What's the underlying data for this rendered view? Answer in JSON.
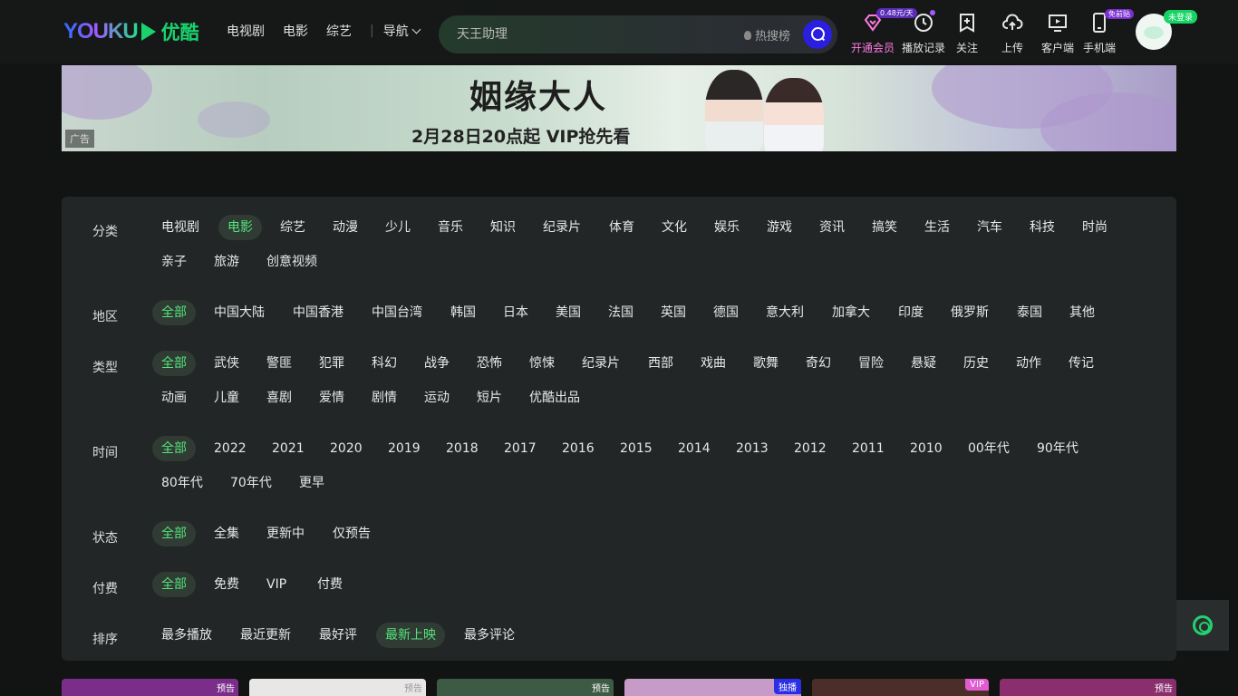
{
  "header": {
    "logo_en": "YOUKU",
    "logo_cn": "优酷",
    "nav": [
      "电视剧",
      "电影",
      "综艺"
    ],
    "nav_more": "导航",
    "search": {
      "placeholder": "天王助理",
      "hot_label": "热搜榜"
    },
    "tools": [
      {
        "label": "开通会员",
        "icon": "diamond-icon"
      },
      {
        "label": "播放记录",
        "icon": "clock-icon"
      },
      {
        "label": "关注",
        "icon": "bookmark-plus-icon"
      },
      {
        "label": "上传",
        "icon": "cloud-upload-icon"
      },
      {
        "label": "客户端",
        "icon": "monitor-play-icon"
      },
      {
        "label": "手机端",
        "icon": "phone-icon"
      }
    ],
    "vip_price_badge": "0.48元/天",
    "mobile_badge": "免前贴",
    "login_tag": "未登录",
    "accent": "#19d36e"
  },
  "ad": {
    "title": "姻缘大人",
    "subtitle": "2月28日20点起 VIP抢先看",
    "label": "广告"
  },
  "filters": [
    {
      "label": "分类",
      "options": [
        "电视剧",
        "电影",
        "综艺",
        "动漫",
        "少儿",
        "音乐",
        "知识",
        "纪录片",
        "体育",
        "文化",
        "娱乐",
        "游戏",
        "资讯",
        "搞笑",
        "生活",
        "汽车",
        "科技",
        "时尚",
        "亲子",
        "旅游",
        "创意视频"
      ],
      "active": 1
    },
    {
      "label": "地区",
      "options": [
        "全部",
        "中国大陆",
        "中国香港",
        "中国台湾",
        "韩国",
        "日本",
        "美国",
        "法国",
        "英国",
        "德国",
        "意大利",
        "加拿大",
        "印度",
        "俄罗斯",
        "泰国",
        "其他"
      ],
      "active": 0
    },
    {
      "label": "类型",
      "options": [
        "全部",
        "武侠",
        "警匪",
        "犯罪",
        "科幻",
        "战争",
        "恐怖",
        "惊悚",
        "纪录片",
        "西部",
        "戏曲",
        "歌舞",
        "奇幻",
        "冒险",
        "悬疑",
        "历史",
        "动作",
        "传记",
        "动画",
        "儿童",
        "喜剧",
        "爱情",
        "剧情",
        "运动",
        "短片",
        "优酷出品"
      ],
      "active": 0
    },
    {
      "label": "时间",
      "options": [
        "全部",
        "2022",
        "2021",
        "2020",
        "2019",
        "2018",
        "2017",
        "2016",
        "2015",
        "2014",
        "2013",
        "2012",
        "2011",
        "2010",
        "00年代",
        "90年代",
        "80年代",
        "70年代",
        "更早"
      ],
      "active": 0
    },
    {
      "label": "状态",
      "options": [
        "全部",
        "全集",
        "更新中",
        "仅预告"
      ],
      "active": 0
    },
    {
      "label": "付费",
      "options": [
        "全部",
        "免费",
        "VIP",
        "付费"
      ],
      "active": 0
    },
    {
      "label": "排序",
      "options": [
        "最多播放",
        "最近更新",
        "最好评",
        "最新上映",
        "最多评论"
      ],
      "active": 3
    }
  ],
  "cards": [
    {
      "tag": "预告",
      "color": "#7a2e8a"
    },
    {
      "tag": "预告",
      "color": "#e9e6e6"
    },
    {
      "tag": "预告",
      "color": "#3d5a44"
    },
    {
      "tag": "独播",
      "color": "#c79bc7",
      "tag_color": "#2a2ee6"
    },
    {
      "tag": "VIP",
      "color": "#4b2e2a",
      "tag_color": "#e25bd0"
    },
    {
      "tag": "预告",
      "color": "#8a2e6e"
    }
  ]
}
